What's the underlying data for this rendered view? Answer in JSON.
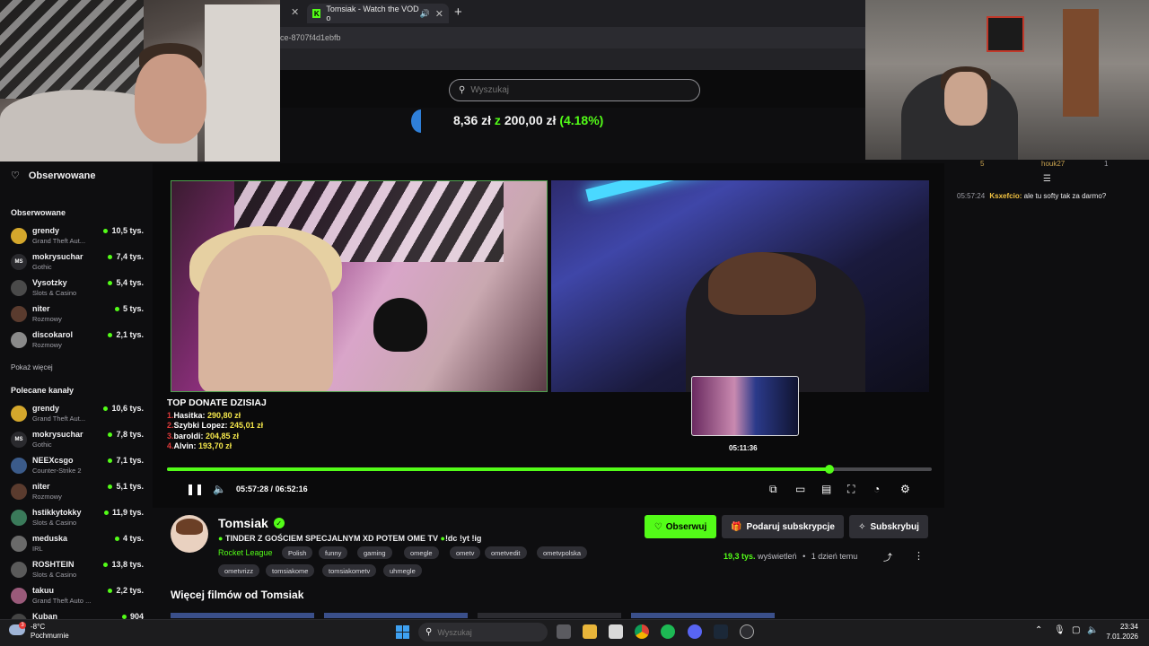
{
  "browser": {
    "active_tab_title": "Tomsiak - Watch the VOD o",
    "address_fragment": "ce-8707f4d1ebfb"
  },
  "topbar": {
    "search_placeholder": "Wyszukaj",
    "goal_current": "8,36 zł",
    "goal_sep": "z",
    "goal_target": "200,00 zł",
    "goal_percent": "(4.18%)",
    "goal_fraction": 0.0418
  },
  "sidebar": {
    "header": "Obserwowane",
    "followed_title": "Obserwowane",
    "followed": [
      {
        "name": "grendy",
        "category": "Grand Theft Aut...",
        "viewers": "10,5 tys.",
        "avatar": "",
        "color": "#d4a72c"
      },
      {
        "name": "mokrysuchar",
        "category": "Gothic",
        "viewers": "7,4 tys.",
        "avatar": "MS",
        "color": "#2a2a2e"
      },
      {
        "name": "Vysotzky",
        "category": "Slots & Casino",
        "viewers": "5,4 tys.",
        "avatar": "",
        "color": "#4a4a4a"
      },
      {
        "name": "niter",
        "category": "Rozmowy",
        "viewers": "5 tys.",
        "avatar": "",
        "color": "#5a3b2e"
      },
      {
        "name": "discokarol",
        "category": "Rozmowy",
        "viewers": "2,1 tys.",
        "avatar": "",
        "color": "#8a8a8a"
      }
    ],
    "show_more": "Pokaż więcej",
    "recommended_title": "Polecane kanały",
    "recommended": [
      {
        "name": "grendy",
        "category": "Grand Theft Aut...",
        "viewers": "10,6 tys.",
        "avatar": "",
        "color": "#d4a72c"
      },
      {
        "name": "mokrysuchar",
        "category": "Gothic",
        "viewers": "7,8 tys.",
        "avatar": "MS",
        "color": "#2a2a2e"
      },
      {
        "name": "NEEXcsgo",
        "category": "Counter-Strike 2",
        "viewers": "7,1 tys.",
        "avatar": "",
        "color": "#3b5b8a"
      },
      {
        "name": "niter",
        "category": "Rozmowy",
        "viewers": "5,1 tys.",
        "avatar": "",
        "color": "#5a3b2e"
      },
      {
        "name": "hstikkytokky",
        "category": "Slots & Casino",
        "viewers": "11,9 tys.",
        "avatar": "",
        "color": "#3a7a5a"
      },
      {
        "name": "meduska",
        "category": "IRL",
        "viewers": "4 tys.",
        "avatar": "",
        "color": "#6a6a6a"
      },
      {
        "name": "ROSHTEIN",
        "category": "Slots & Casino",
        "viewers": "13,8 tys.",
        "avatar": "",
        "color": "#5a5a5a"
      },
      {
        "name": "takuu",
        "category": "Grand Theft Auto ...",
        "viewers": "2,2 tys.",
        "avatar": "",
        "color": "#9a5a7a"
      },
      {
        "name": "Kuban",
        "category": "",
        "viewers": "904",
        "avatar": "",
        "color": "#444"
      }
    ]
  },
  "chat": {
    "top_user1": "5",
    "top_user2": "houk27",
    "top_user3": "1",
    "message": {
      "time": "05:57:24",
      "user": "Ksxefcio:",
      "text": "ale tu softy tak za darmo?"
    }
  },
  "video": {
    "donate_title": "TOP DONATE DZISIAJ",
    "donations": [
      {
        "rank": "1.",
        "name": "Hasitka:",
        "amount": "290,80 zł"
      },
      {
        "rank": "2.",
        "name": "Szybki Lopez:",
        "amount": "245,01 zł"
      },
      {
        "rank": "3.",
        "name": "baroldi:",
        "amount": "204,85 zł"
      },
      {
        "rank": "4.",
        "name": "Alvin:",
        "amount": "193,70 zł"
      }
    ],
    "preview_time": "05:11:36",
    "current_time": "05:57:28",
    "time_sep": "/",
    "duration": "06:52:16",
    "progress": 0.8667
  },
  "channel": {
    "name": "Tomsiak",
    "title": "TINDER Z GOŚCIEM SPECJALNYM XD POTEM OME TV",
    "title_suffix": "!dc !yt !ig",
    "category": "Rocket League",
    "tags_row1": [
      "Polish",
      "funny",
      "gaming",
      "omegle",
      "ometv",
      "ometvedit",
      "ometvpolska"
    ],
    "tags_row2": [
      "ometvrizz",
      "tomsiakome",
      "tomsiakometv",
      "uhmegle"
    ],
    "follow_label": "Obserwuj",
    "gift_label": "Podaruj subskrypcje",
    "sub_label": "Subskrybuj",
    "views_num": "19,3 tys.",
    "views_label": "wyświetleń",
    "ago": "1 dzień temu",
    "more_videos": "Więcej filmów od Tomsiak"
  },
  "taskbar": {
    "weather_badge": "3",
    "temp": "-8°C",
    "condition": "Pochmurnie",
    "search_placeholder": "Wyszukaj",
    "time": "23:34",
    "date": "7.01.2026"
  }
}
